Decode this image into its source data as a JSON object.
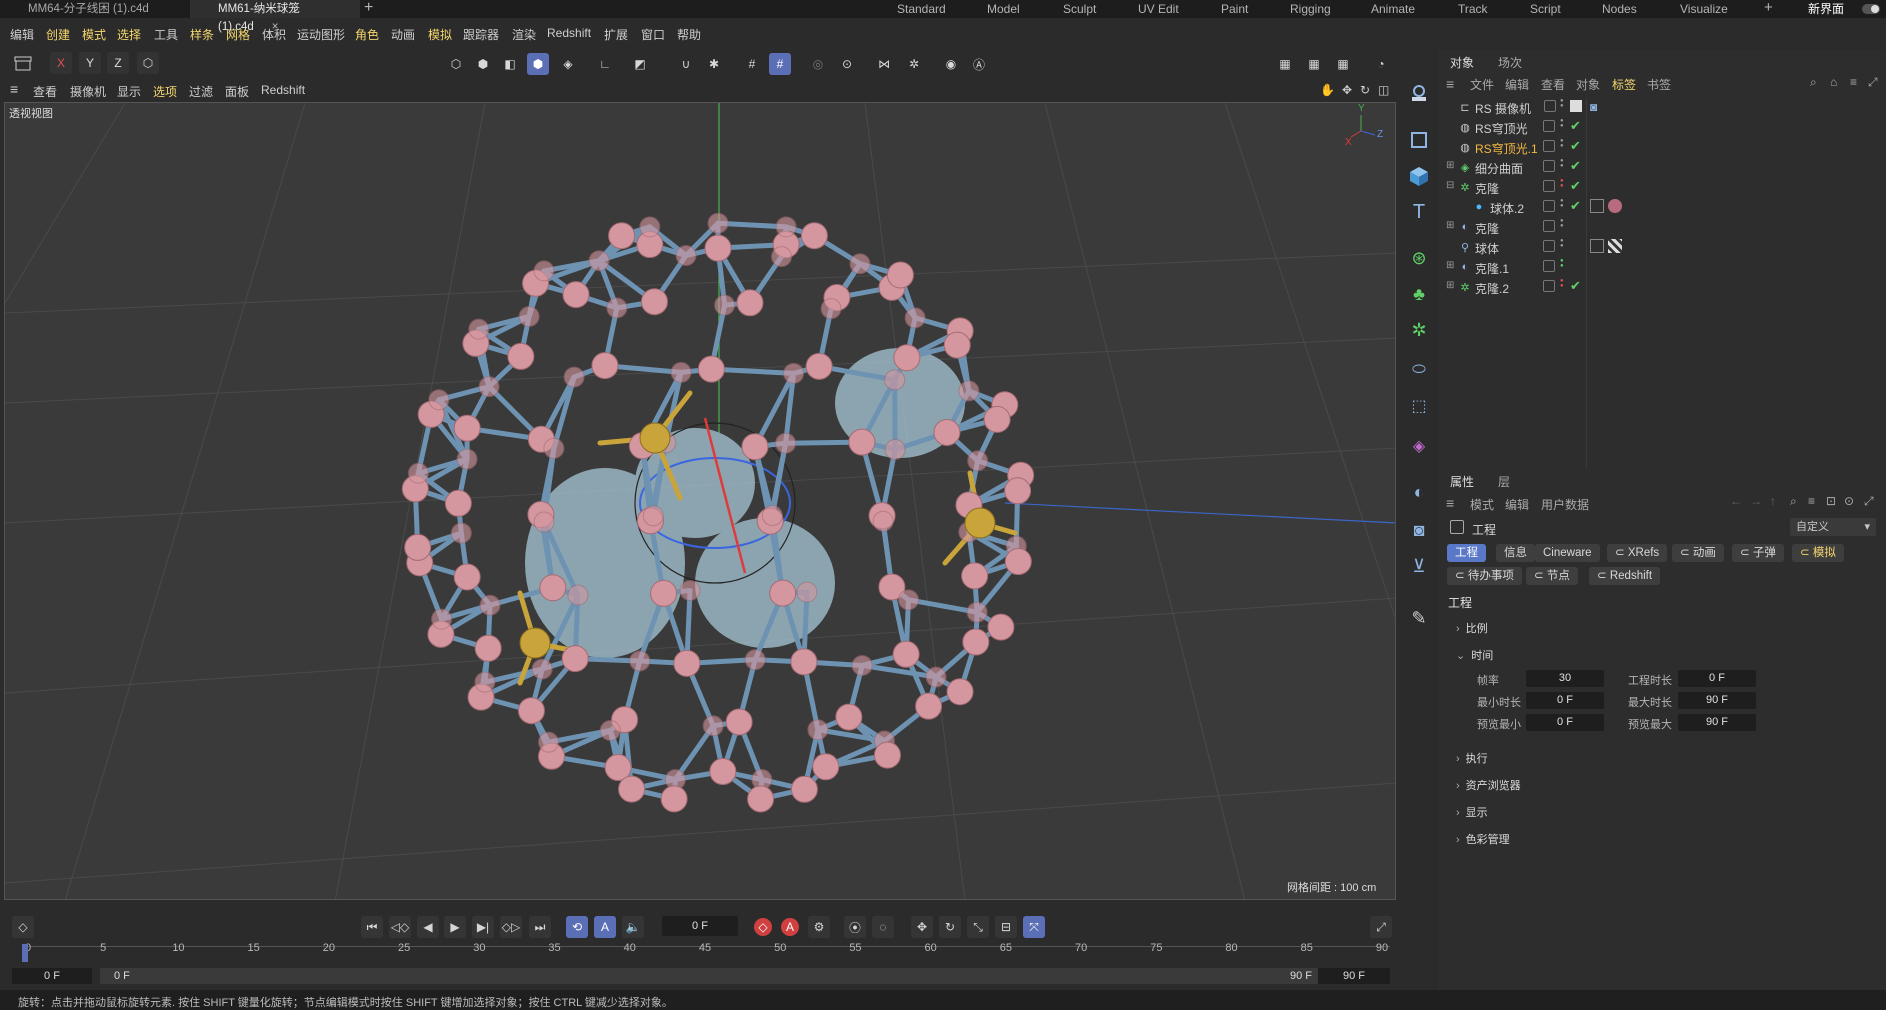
{
  "titlebar": {
    "tabs": [
      {
        "label": "MM64-分子线困   (1).c4d"
      },
      {
        "label": "MM61-纳米球笼 (1).c4d",
        "close": "×"
      }
    ],
    "add_tab": "+",
    "layouts": [
      "Standard",
      "Model",
      "Sculpt",
      "UV Edit",
      "Paint",
      "Rigging",
      "Animate",
      "Track",
      "Script",
      "Nodes",
      "Visualize"
    ],
    "new_layout_label": "新界面"
  },
  "menubar": {
    "items": [
      "编辑",
      "创建",
      "模式",
      "选择",
      "工具",
      "样条",
      "网格",
      "体积",
      "运动图形",
      "角色",
      "动画",
      "模拟",
      "跟踪器",
      "渲染",
      "Redshift",
      "扩展",
      "窗口",
      "帮助"
    ]
  },
  "toolbar": {
    "axes": [
      "X",
      "Y",
      "Z"
    ]
  },
  "viewport_menu": {
    "items": [
      "查看",
      "摄像机",
      "显示",
      "选项",
      "过滤",
      "面板",
      "Redshift"
    ]
  },
  "viewport": {
    "label": "透视视图",
    "grid_info": "网格间距 : 100 cm",
    "gizmo": {
      "x": "X",
      "y": "Y",
      "z": "Z"
    }
  },
  "object_panel": {
    "tabs": [
      "对象",
      "场次"
    ],
    "menu": [
      "文件",
      "编辑",
      "查看",
      "对象",
      "标签",
      "书签"
    ],
    "objects": [
      {
        "name": "RS 摄像机",
        "icon": "camera-icon",
        "check": ""
      },
      {
        "name": "RS穹顶光",
        "icon": "dome-light-icon",
        "check": "✔"
      },
      {
        "name": "RS穹顶光.1",
        "icon": "dome-light-icon",
        "check": "✔",
        "selected": true
      },
      {
        "name": "细分曲面",
        "icon": "subdivision-icon",
        "check": "✔"
      },
      {
        "name": "克隆",
        "icon": "cloner-icon",
        "check": "✔"
      },
      {
        "name": "球体.2",
        "icon": "sphere-icon",
        "check": "✔"
      },
      {
        "name": "克隆",
        "icon": "cloner-icon",
        "check": ""
      },
      {
        "name": "球体",
        "icon": "sphere-icon",
        "check": ""
      },
      {
        "name": "克隆.1",
        "icon": "cloner-icon",
        "check": ""
      },
      {
        "name": "克隆.2",
        "icon": "cloner-icon",
        "check": "✔"
      }
    ]
  },
  "attr_panel": {
    "tabs": [
      "属性",
      "层"
    ],
    "menu": [
      "模式",
      "编辑",
      "用户数据"
    ],
    "object_label": "工程",
    "preset": "自定义",
    "chips_row1": [
      "工程",
      "信息",
      "Cineware",
      "XRefs",
      "动画",
      "子弹",
      "模拟"
    ],
    "chips_row2": [
      "待办事项",
      "节点",
      "Redshift"
    ],
    "section_title": "工程",
    "groups": {
      "scale": "比例",
      "time": "时间",
      "execute": "执行",
      "assets": "资产浏览器",
      "display": "显示",
      "color": "色彩管理"
    },
    "fields": {
      "fps_label": "帧率",
      "fps": "30",
      "proj_len_label": "工程时长",
      "proj_len": "0 F",
      "min_len_label": "最小时长",
      "min_len": "0 F",
      "max_len_label": "最大时长",
      "max_len": "90 F",
      "prev_min_label": "预览最小",
      "prev_min": "0 F",
      "prev_max_label": "预览最大",
      "prev_max": "90 F"
    }
  },
  "timeline": {
    "current_frame": "0 F",
    "ruler": [
      "0",
      "5",
      "10",
      "15",
      "20",
      "25",
      "30",
      "35",
      "40",
      "45",
      "50",
      "55",
      "60",
      "65",
      "70",
      "75",
      "80",
      "85",
      "90"
    ],
    "range_start": "0 F",
    "range_start2": "0 F",
    "range_end": "90 F",
    "range_end2": "90 F"
  },
  "status": {
    "text": "旋转：点击并拖动鼠标旋转元素. 按住 SHIFT 键量化旋转；节点编辑模式时按住 SHIFT 键增加选择对象；按住 CTRL 键减少选择对象。"
  },
  "colors": {
    "accent": "#5a78c8",
    "highlight_text": "#f5d76e",
    "selected_object": "#f5b942",
    "check": "#5fd068",
    "rod": "#6e93b2",
    "atom": "#d4979f",
    "gold": "#c9a43a",
    "blob": "#a8c8d8"
  }
}
